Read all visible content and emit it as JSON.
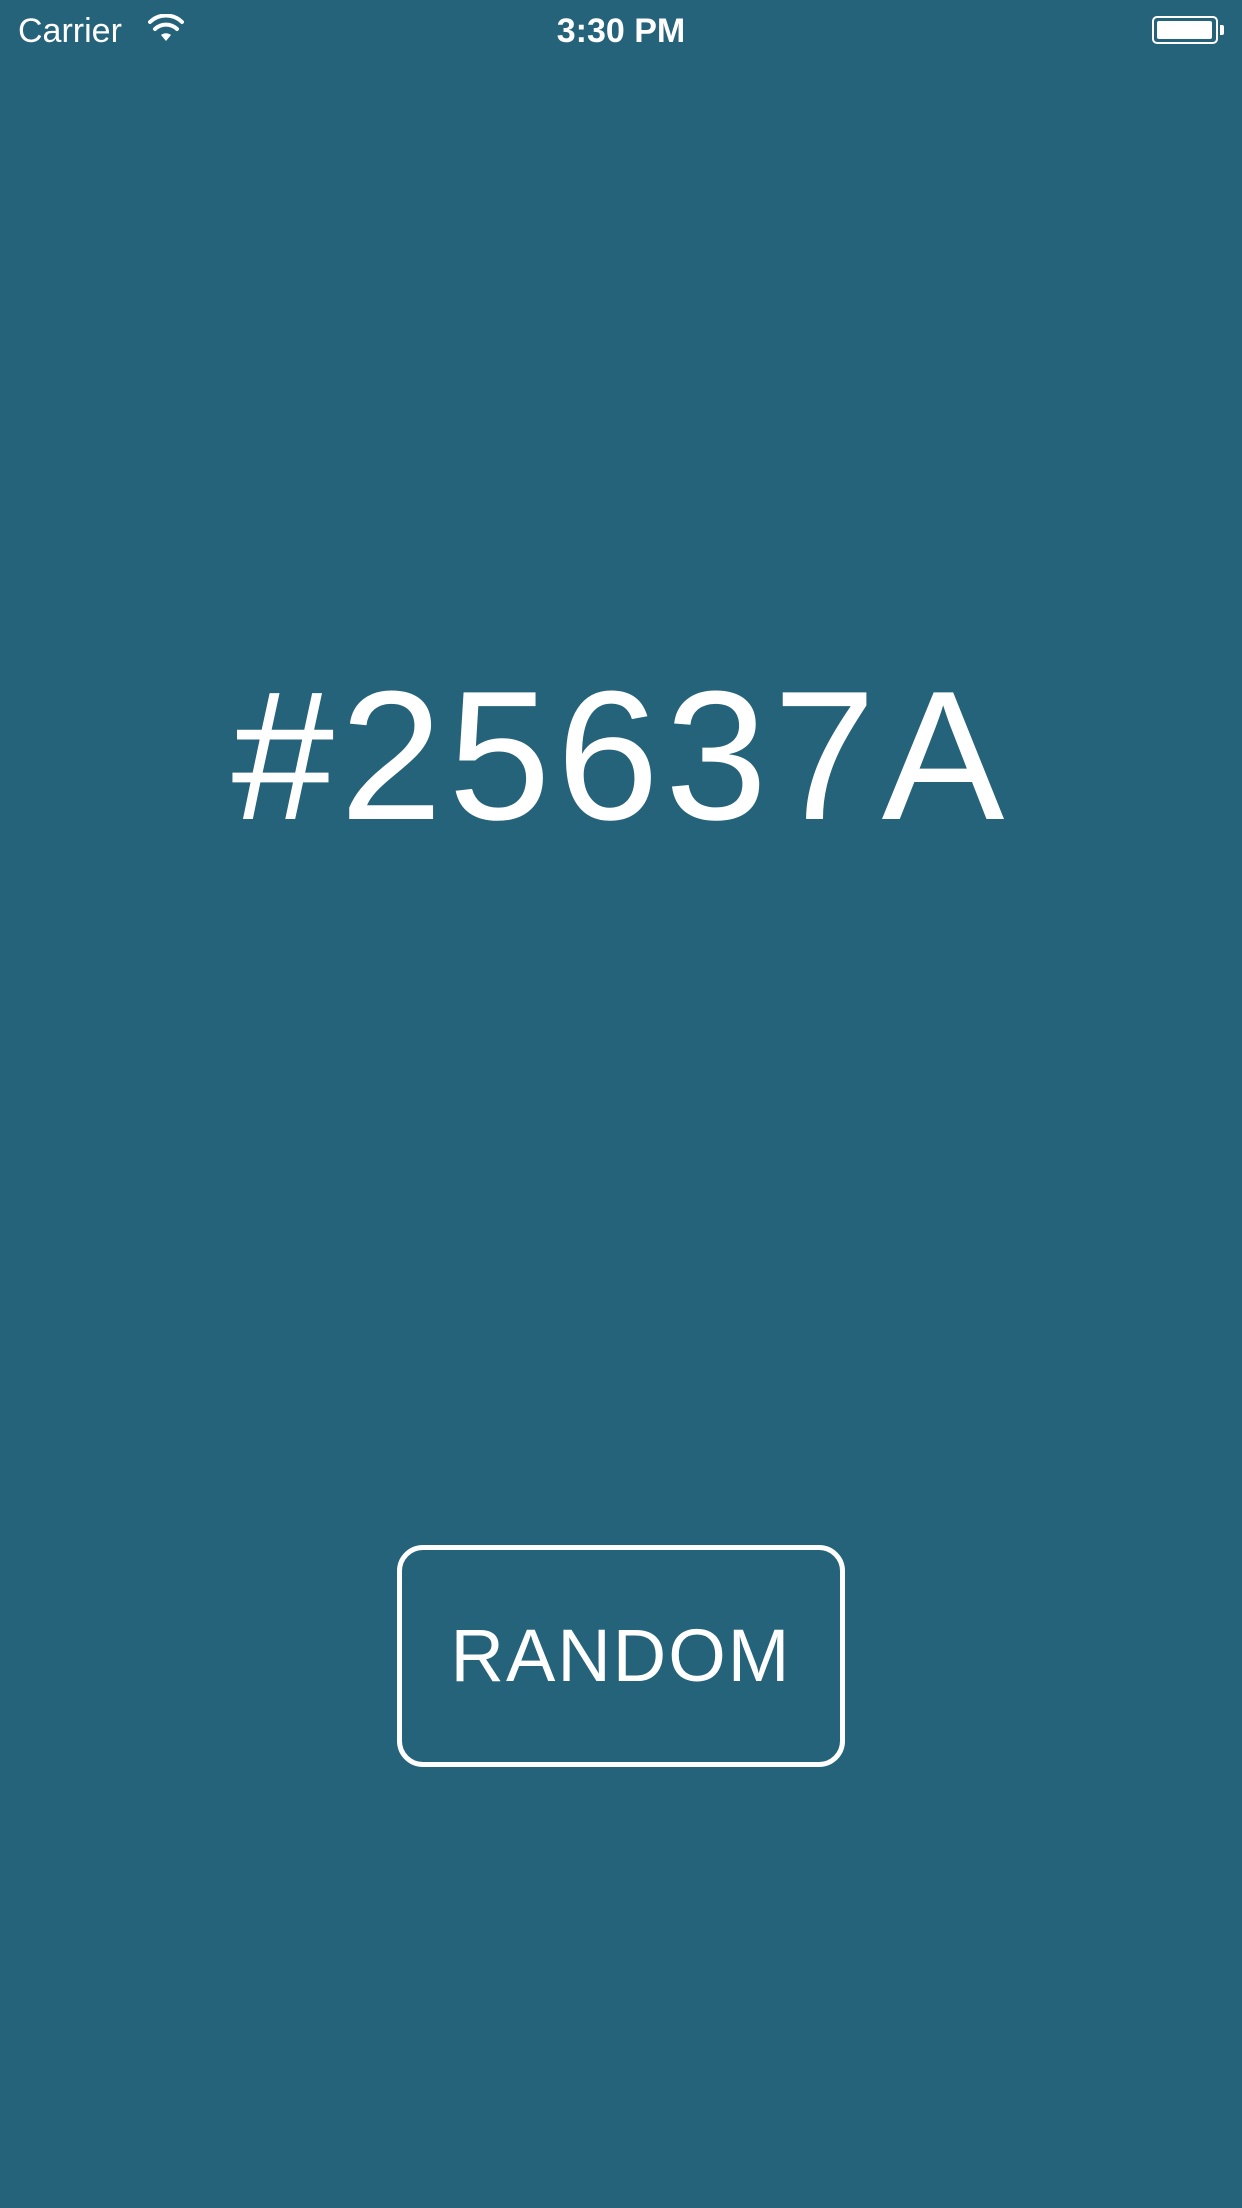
{
  "status_bar": {
    "carrier": "Carrier",
    "time": "3:30 PM",
    "wifi_icon": "wifi-icon",
    "battery_icon": "battery-icon",
    "battery_level": 0.98
  },
  "main": {
    "hex_value": "#25637A",
    "background_color": "#25637A",
    "random_button_label": "RANDOM"
  }
}
